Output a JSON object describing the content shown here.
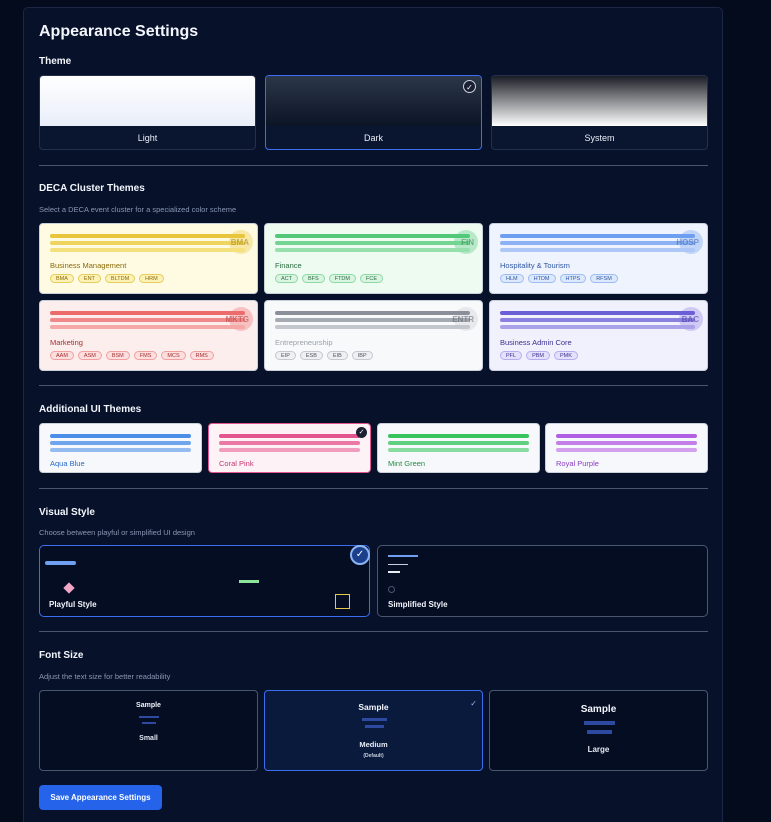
{
  "title": "Appearance Settings",
  "theme": {
    "heading": "Theme",
    "options": [
      {
        "label": "Light",
        "selected": false
      },
      {
        "label": "Dark",
        "selected": true
      },
      {
        "label": "System",
        "selected": false
      }
    ]
  },
  "clusters": {
    "heading": "DECA Cluster Themes",
    "subtitle": "Select a DECA event cluster for a specialized color scheme",
    "items": [
      {
        "code": "BMA",
        "name": "Business Management",
        "tags": [
          "BMA",
          "ENT",
          "BLTDM",
          "HRM"
        ],
        "color": "#e8c53a"
      },
      {
        "code": "FIN",
        "name": "Finance",
        "tags": [
          "ACT",
          "BFS",
          "FTDM",
          "FCE"
        ],
        "color": "#52c97a"
      },
      {
        "code": "HOSP",
        "name": "Hospitality & Tourism",
        "tags": [
          "HLM",
          "HTDM",
          "HTPS",
          "RFSM"
        ],
        "color": "#6e9ef0"
      },
      {
        "code": "MKTG",
        "name": "Marketing",
        "tags": [
          "AAM",
          "ASM",
          "BSM",
          "FMS",
          "MCS",
          "RMS"
        ],
        "color": "#ec6c6c"
      },
      {
        "code": "ENTR",
        "name": "Entrepreneurship",
        "tags": [
          "EIP",
          "ESB",
          "EIB",
          "IBP"
        ],
        "color": "#8a8f99"
      },
      {
        "code": "BAC",
        "name": "Business Admin Core",
        "tags": [
          "PFL",
          "PBM",
          "PMK"
        ],
        "color": "#6b5fd6"
      }
    ]
  },
  "ui_themes": {
    "heading": "Additional UI Themes",
    "items": [
      {
        "name": "Aqua Blue",
        "color": "#4a8ee8",
        "selected": false
      },
      {
        "name": "Coral Pink",
        "color": "#e4558f",
        "selected": true
      },
      {
        "name": "Mint Green",
        "color": "#37c45f",
        "selected": false
      },
      {
        "name": "Royal Purple",
        "color": "#b15fe3",
        "selected": false
      }
    ]
  },
  "visual_style": {
    "heading": "Visual Style",
    "subtitle": "Choose between playful or simplified UI design",
    "options": [
      {
        "label": "Playful Style",
        "selected": true
      },
      {
        "label": "Simplified Style",
        "selected": false
      }
    ]
  },
  "font_size": {
    "heading": "Font Size",
    "subtitle": "Adjust the text size for better readability",
    "options": [
      {
        "sample": "Sample",
        "label": "Small",
        "note": "",
        "selected": false
      },
      {
        "sample": "Sample",
        "label": "Medium",
        "note": "(Default)",
        "selected": true
      },
      {
        "sample": "Sample",
        "label": "Large",
        "note": "",
        "selected": false
      }
    ]
  },
  "save_label": "Save Appearance Settings",
  "check_glyph": "✓"
}
